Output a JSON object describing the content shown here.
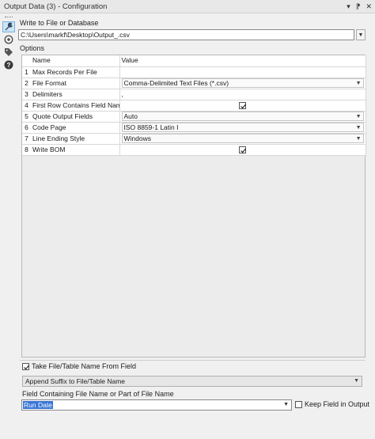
{
  "window": {
    "title": "Output Data (3) - Configuration",
    "controls": [
      "▾",
      "⁋",
      "✕"
    ]
  },
  "toolbar": {
    "icons": [
      "configuration-icon",
      "tool-properties-icon",
      "tag-icon",
      "help-icon"
    ]
  },
  "write": {
    "label": "Write to File or Database",
    "path": "C:\\Users\\markf\\Desktop\\Output_.csv"
  },
  "options": {
    "label": "Options",
    "columns": [
      "Name",
      "Value"
    ],
    "rows": [
      {
        "num": "1",
        "name": "Max Records Per File",
        "value": "",
        "kind": "text"
      },
      {
        "num": "2",
        "name": "File Format",
        "value": "Comma-Delimited Text Files (*.csv)",
        "kind": "dropdown"
      },
      {
        "num": "3",
        "name": "Delimiters",
        "value": ",",
        "kind": "text"
      },
      {
        "num": "4",
        "name": "First Row Contains Field Names",
        "value": "checked",
        "kind": "checkbox"
      },
      {
        "num": "5",
        "name": "Quote Output Fields",
        "value": "Auto",
        "kind": "dropdown"
      },
      {
        "num": "6",
        "name": "Code Page",
        "value": "ISO 8859-1 Latin I",
        "kind": "dropdown"
      },
      {
        "num": "7",
        "name": "Line Ending Style",
        "value": "Windows",
        "kind": "dropdown"
      },
      {
        "num": "8",
        "name": "Write BOM",
        "value": "checked",
        "kind": "checkbox"
      }
    ]
  },
  "bottom": {
    "take_label": "Take File/Table Name From Field",
    "take_checked": true,
    "suffix_value": "Append Suffix to File/Table Name",
    "field_label": "Field Containing File Name or Part of File Name",
    "field_value": "Run Date",
    "keep_label": "Keep Field in Output",
    "keep_checked": false
  },
  "colors": {
    "selection": "#3875d7",
    "ok_icon": "#1f6e3a"
  }
}
